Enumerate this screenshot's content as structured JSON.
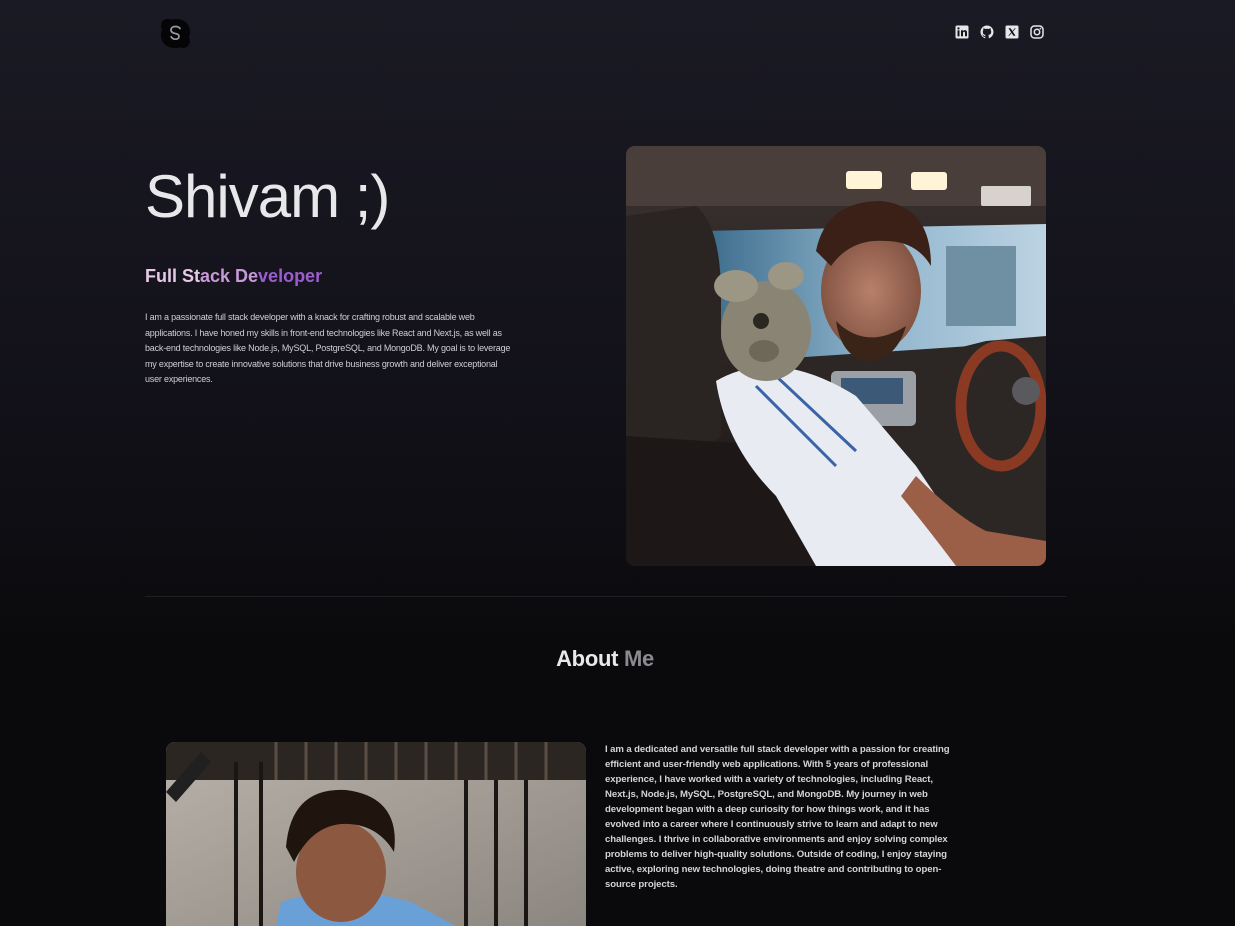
{
  "header": {
    "logo_icon": "skype-style-s-logo-icon",
    "social_icons": [
      "linkedin-icon",
      "github-icon",
      "x-twitter-icon",
      "instagram-icon"
    ]
  },
  "hero": {
    "name": "Shivam ;)",
    "role": {
      "part1": "Full St",
      "part2": "ack De",
      "part3": "veloper"
    },
    "description": "I am a passionate full stack developer with a knack for crafting robust and scalable web applications. I have honed my skills in front-end technologies like React and Next.js, as well as back-end technologies like Node.js, MySQL, PostgreSQL, and MongoDB. My goal is to leverage my expertise to create innovative solutions that drive business growth and deliver exceptional user experiences."
  },
  "about": {
    "title_a": "About",
    "title_b": "Me",
    "text": "I am a dedicated and versatile full stack developer with a passion for creating efficient and user-friendly web applications. With 5 years of professional experience, I have worked with a variety of technologies, including React, Next.js, Node.js, MySQL, PostgreSQL, and MongoDB. My journey in web development began with a deep curiosity for how things work, and it has evolved into a career where I continuously strive to learn and adapt to new challenges. I thrive in collaborative environments and enjoy solving complex problems to deliver high-quality solutions. Outside of coding, I enjoy staying active, exploring new technologies, doing theatre and contributing to open-source projects."
  },
  "colors": {
    "background_top": "#1a1a24",
    "background_bottom": "#0a0a0c",
    "name_text": "#e8e8ea",
    "role_gradient_start": "#e6c9e6",
    "role_gradient_end": "#9b5ed0",
    "muted_text": "#8a8a90"
  }
}
